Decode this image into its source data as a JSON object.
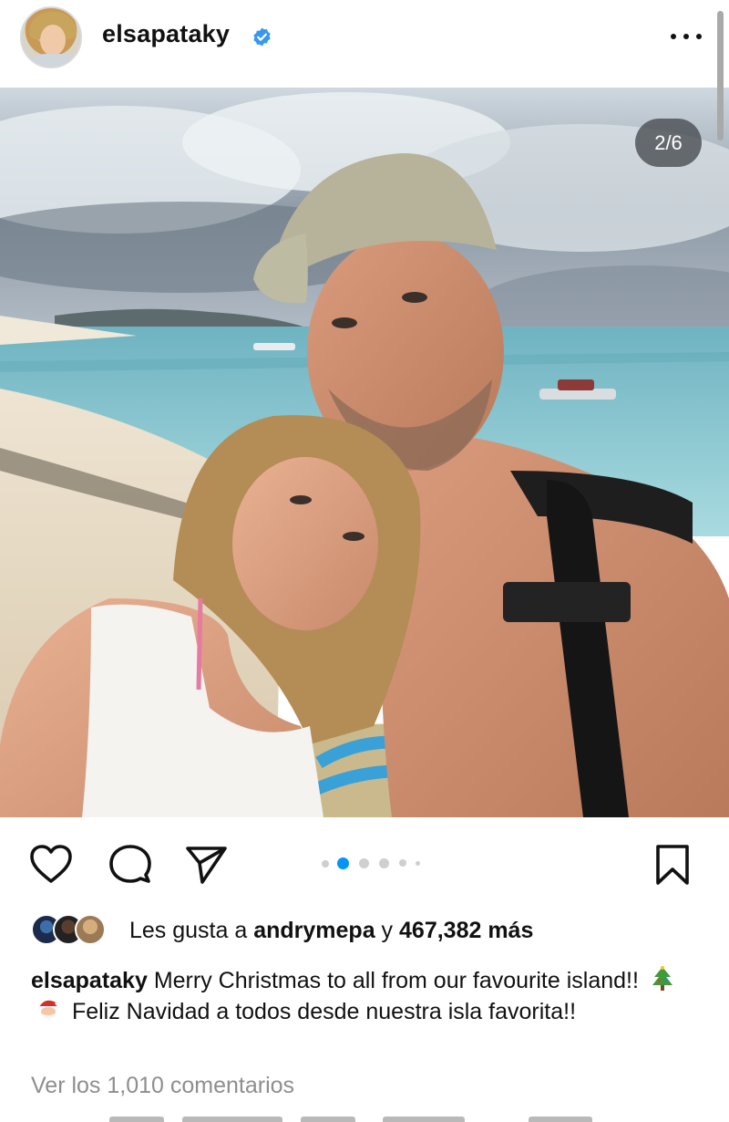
{
  "post": {
    "username": "elsapataky",
    "verified": true,
    "more_icon": "more-horizontal-icon",
    "carousel_counter": "2/6",
    "carousel_dots": 6,
    "carousel_active_index": 1
  },
  "actions": {
    "like_icon": "heart-icon",
    "comment_icon": "comment-icon",
    "share_icon": "send-icon",
    "save_icon": "bookmark-icon"
  },
  "likes": {
    "prefix": "Les gusta a ",
    "user": "andrymepa",
    "joiner": " y ",
    "count": "467,382 más"
  },
  "caption": {
    "username": "elsapataky",
    "text_part1": " Merry Christmas to all from our favourite island!! ",
    "emoji1": "🎄",
    "emoji2": "🎅",
    "text_part2": " Feliz Navidad a todos desde nuestra isla favorita!!"
  },
  "comments": {
    "view_all": "Ver los 1,010 comentarios"
  },
  "colors": {
    "verified_blue": "#3897f0",
    "active_dot": "#0095f6",
    "secondary_text": "#8e8e8e"
  }
}
